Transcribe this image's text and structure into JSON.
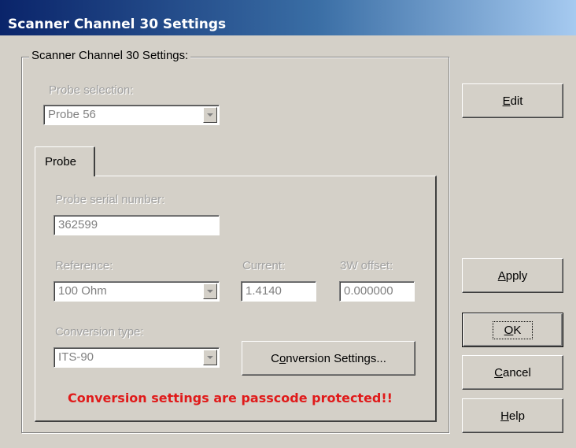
{
  "window": {
    "title": "Scanner Channel 30 Settings"
  },
  "group": {
    "caption": "Scanner Channel 30 Settings:"
  },
  "probe_selection": {
    "label": "Probe selection:",
    "value": "Probe 56"
  },
  "tabs": [
    {
      "label": "Probe"
    }
  ],
  "probe_tab": {
    "serial_label": "Probe serial number:",
    "serial_value": "362599",
    "reference_label": "Reference:",
    "reference_value": "100 Ohm",
    "current_label": "Current:",
    "current_value": "1.4140",
    "offset_label": "3W offset:",
    "offset_value": "0.000000",
    "conversion_type_label": "Conversion type:",
    "conversion_type_value": "ITS-90",
    "conversion_settings_button": {
      "pre": "C",
      "ul": "o",
      "post": "nversion Settings..."
    },
    "warning": "Conversion settings are passcode protected!!"
  },
  "buttons": {
    "edit": {
      "ul": "E",
      "post": "dit"
    },
    "apply": {
      "ul": "A",
      "post": "pply"
    },
    "ok": {
      "ul": "O",
      "post": "K"
    },
    "cancel": {
      "ul": "C",
      "post": "ancel"
    },
    "help": {
      "ul": "H",
      "post": "elp"
    }
  },
  "colors": {
    "titlebar_start": "#0a246a",
    "titlebar_end": "#a6caf0",
    "dialog_bg": "#d4d0c8",
    "warning_text": "#e01a1a",
    "disabled_text": "#a0a0a0"
  }
}
